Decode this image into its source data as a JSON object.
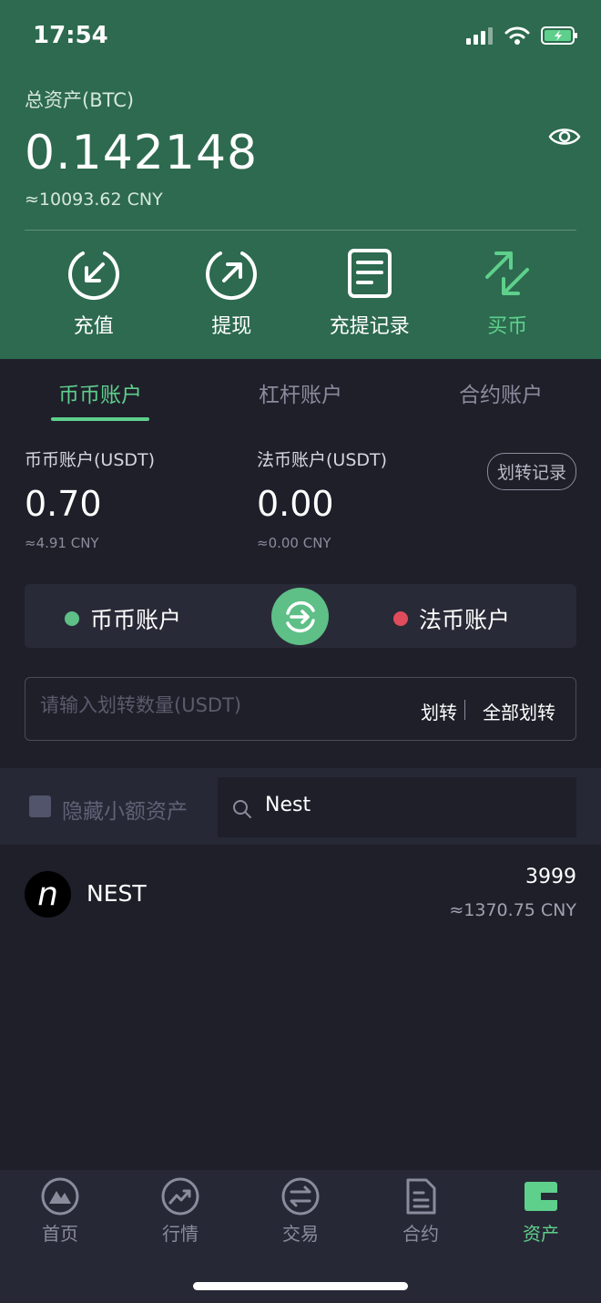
{
  "status": {
    "time": "17:54"
  },
  "header": {
    "total_label": "总资产(BTC)",
    "total_value": "0.142148",
    "total_cny": "≈10093.62 CNY"
  },
  "actions": [
    {
      "label": "充值",
      "icon": "deposit-icon"
    },
    {
      "label": "提现",
      "icon": "withdraw-icon"
    },
    {
      "label": "充提记录",
      "icon": "records-icon"
    },
    {
      "label": "买币",
      "icon": "buy-icon"
    }
  ],
  "tabs": [
    {
      "label": "币币账户",
      "active": true
    },
    {
      "label": "杠杆账户",
      "active": false
    },
    {
      "label": "合约账户",
      "active": false
    }
  ],
  "accounts": {
    "spot": {
      "name": "币币账户(USDT)",
      "value": "0.70",
      "cny": "≈4.91 CNY"
    },
    "fiat": {
      "name": "法币账户(USDT)",
      "value": "0.00",
      "cny": "≈0.00 CNY"
    },
    "record_label": "划转记录"
  },
  "switcher": {
    "from": "币币账户",
    "to": "法币账户",
    "from_color": "#5ebf87",
    "to_color": "#e04c5c"
  },
  "transfer": {
    "placeholder": "请输入划转数量(USDT)",
    "transfer_label": "划转",
    "transfer_all_label": "全部划转"
  },
  "filter": {
    "hide_small_label": "隐藏小额资产",
    "search_value": "Nest"
  },
  "assets": [
    {
      "logo": "n",
      "name": "NEST",
      "amount": "3999",
      "cny": "≈1370.75 CNY"
    }
  ],
  "nav": [
    {
      "label": "首页",
      "icon": "home-icon",
      "active": false
    },
    {
      "label": "行情",
      "icon": "market-icon",
      "active": false
    },
    {
      "label": "交易",
      "icon": "trade-icon",
      "active": false
    },
    {
      "label": "合约",
      "icon": "contract-icon",
      "active": false
    },
    {
      "label": "资产",
      "icon": "assets-icon",
      "active": true
    }
  ],
  "colors": {
    "header_bg": "#2d6a4f",
    "accent": "#5ed08c",
    "bg": "#1f1f2a"
  }
}
